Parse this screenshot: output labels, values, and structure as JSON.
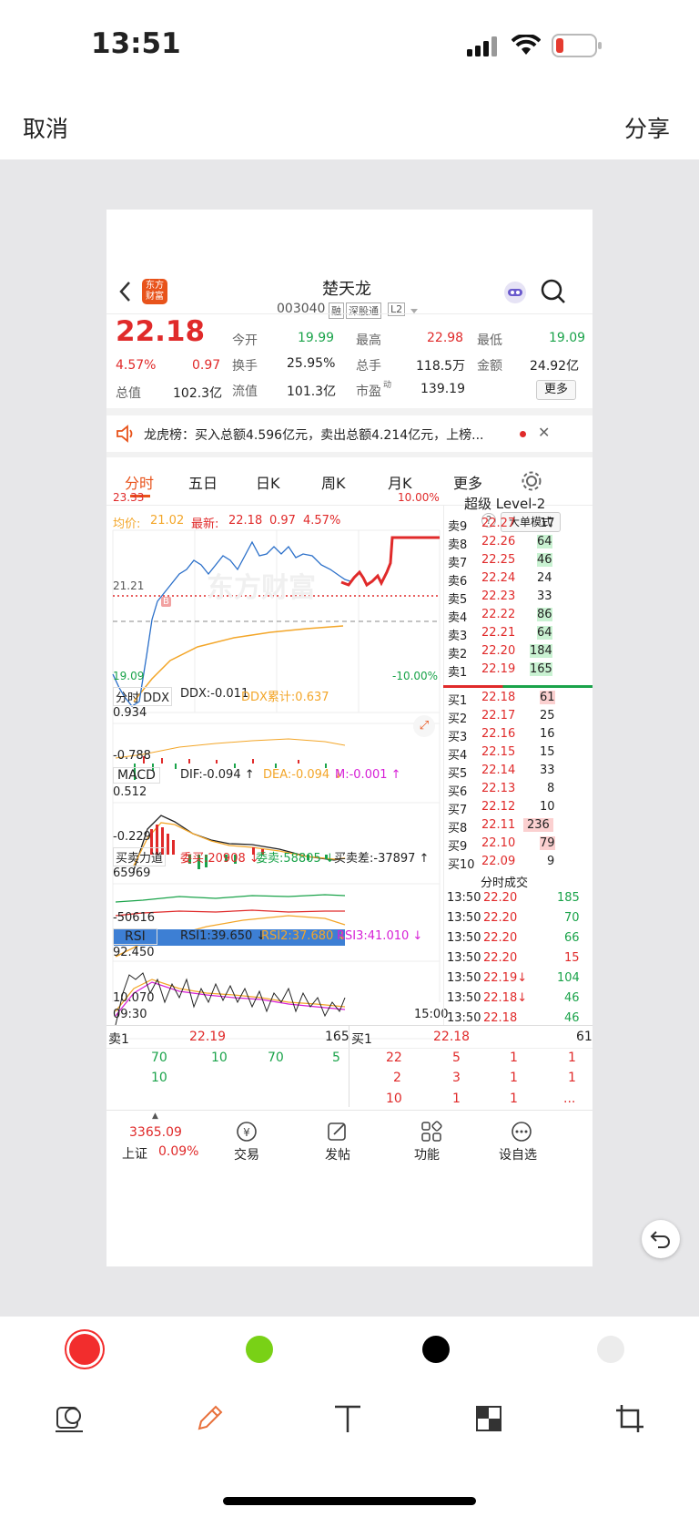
{
  "status": {
    "time": "13:51"
  },
  "editor": {
    "cancel": "取消",
    "share": "分享"
  },
  "app": {
    "logo_line1": "东方",
    "logo_line2": "财富",
    "stock_name": "楚天龙",
    "stock_code": "003040",
    "tags": [
      "融",
      "深股通",
      "L2"
    ],
    "price": "22.18",
    "change_pct": "4.57%",
    "change": "0.97",
    "quote": {
      "open_label": "今开",
      "open": "19.99",
      "high_label": "最高",
      "high": "22.98",
      "low_label": "最低",
      "low": "19.09",
      "turnover_label": "换手",
      "turnover": "25.95%",
      "volume_label": "总手",
      "volume": "118.5万",
      "amount_label": "金额",
      "amount": "24.92亿",
      "mcap_label": "总值",
      "mcap": "102.3亿",
      "float_label": "流值",
      "float": "101.3亿",
      "pe_label": "市盈",
      "pe_sup": "动",
      "pe": "139.19",
      "more": "更多"
    },
    "notice": "龙虎榜：买入总额4.596亿元，卖出总额4.214亿元，上榜...",
    "tabs": [
      "分时",
      "五日",
      "日K",
      "周K",
      "月K",
      "更多"
    ],
    "chart_head": {
      "avg_label": "均价:",
      "avg": "21.02",
      "last_label": "最新:",
      "last": "22.18",
      "chg": "0.97",
      "pct": "4.57%",
      "mode_btn": "大单模式"
    },
    "price_axis": {
      "top": "23.33",
      "mid": "21.21",
      "bottom": "19.09",
      "top_pct": "10.00%",
      "bottom_pct": "-10.00%"
    },
    "marker_b": "B",
    "watermark": "东方财富",
    "ddx": {
      "name": "分时 DDX",
      "ddx": "DDX:-0.011",
      "ddx_sum": "DDX累计:0.637",
      "top": "0.934",
      "bottom": "-0.788"
    },
    "macd": {
      "name": "MACD",
      "dif": "DIF:-0.094 ↑",
      "dea": "DEA:-0.094 ↓",
      "m": "M:-0.001 ↑",
      "top": "0.512",
      "bottom": "-0.229"
    },
    "force": {
      "name": "买卖力道",
      "buy": "委买:20908 ↓",
      "sell": "委卖:58805 ↓",
      "diff": "买卖差:-37897 ↑",
      "top": "65969",
      "bottom": "-50616"
    },
    "rsi": {
      "name": "RSI",
      "rsi1": "RSI1:39.650 ↓",
      "rsi2": "RSI2:37.680 ↓",
      "rsi3": "RSI3:41.010 ↓",
      "top": "92.450",
      "bottom": "10.070"
    },
    "time_axis": {
      "start": "09:30",
      "end": "15:00"
    },
    "level2_title": "超级 Level-2",
    "asks": [
      {
        "label": "卖9",
        "price": "22.27",
        "vol": "17"
      },
      {
        "label": "卖8",
        "price": "22.26",
        "vol": "64"
      },
      {
        "label": "卖7",
        "price": "22.25",
        "vol": "46"
      },
      {
        "label": "卖6",
        "price": "22.24",
        "vol": "24"
      },
      {
        "label": "卖5",
        "price": "22.23",
        "vol": "33"
      },
      {
        "label": "卖4",
        "price": "22.22",
        "vol": "86"
      },
      {
        "label": "卖3",
        "price": "22.21",
        "vol": "64"
      },
      {
        "label": "卖2",
        "price": "22.20",
        "vol": "184"
      },
      {
        "label": "卖1",
        "price": "22.19",
        "vol": "165"
      }
    ],
    "bids": [
      {
        "label": "买1",
        "price": "22.18",
        "vol": "61"
      },
      {
        "label": "买2",
        "price": "22.17",
        "vol": "25"
      },
      {
        "label": "买3",
        "price": "22.16",
        "vol": "16"
      },
      {
        "label": "买4",
        "price": "22.15",
        "vol": "15"
      },
      {
        "label": "买5",
        "price": "22.14",
        "vol": "33"
      },
      {
        "label": "买6",
        "price": "22.13",
        "vol": "8"
      },
      {
        "label": "买7",
        "price": "22.12",
        "vol": "10"
      },
      {
        "label": "买8",
        "price": "22.11",
        "vol": "236"
      },
      {
        "label": "买9",
        "price": "22.10",
        "vol": "79"
      },
      {
        "label": "买10",
        "price": "22.09",
        "vol": "9"
      }
    ],
    "trades_title": "分时成交",
    "trades": [
      {
        "time": "13:50",
        "price": "22.20",
        "vol": "185"
      },
      {
        "time": "13:50",
        "price": "22.20",
        "vol": "70"
      },
      {
        "time": "13:50",
        "price": "22.20",
        "vol": "66"
      },
      {
        "time": "13:50",
        "price": "22.20",
        "vol": "15"
      },
      {
        "time": "13:50",
        "price": "22.19↓",
        "vol": "104"
      },
      {
        "time": "13:50",
        "price": "22.18↓",
        "vol": "46"
      },
      {
        "time": "13:50",
        "price": "22.18",
        "vol": "46"
      }
    ],
    "queue": {
      "sell_label": "卖1",
      "sell_price": "22.19",
      "sell_total": "165",
      "buy_label": "买1",
      "buy_price": "22.18",
      "buy_total": "61",
      "sell_row1": [
        "70",
        "10",
        "70",
        "5"
      ],
      "sell_row2": [
        "10"
      ],
      "buy_row1": [
        "22",
        "5",
        "1",
        "1"
      ],
      "buy_row2": [
        "2",
        "3",
        "1",
        "1"
      ],
      "buy_row3": [
        "10",
        "1",
        "1",
        "..."
      ]
    },
    "bottom_nav": {
      "index_value": "3365.09",
      "index_name": "上证",
      "index_pct": "0.09%",
      "trade": "交易",
      "post": "发帖",
      "func": "功能",
      "watch": "设自选"
    }
  },
  "colors": {
    "up": "#e02a2a",
    "down": "#1aa34a",
    "accent": "#e8531b",
    "price_line": "#2a6fc9",
    "avg_line": "#f3a629"
  }
}
